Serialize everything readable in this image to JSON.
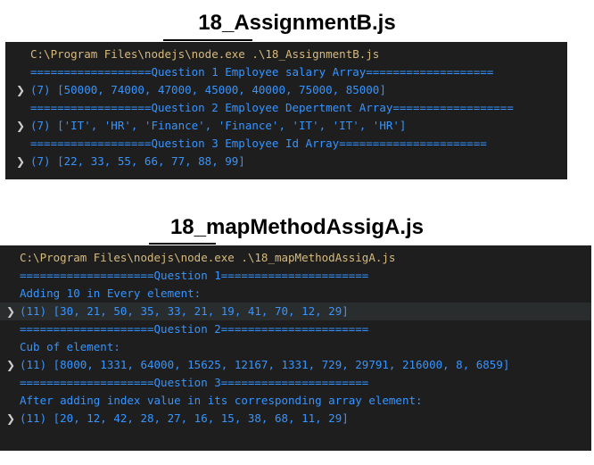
{
  "section1": {
    "heading": "18_AssignmentB.js",
    "lines": [
      {
        "text": "C:\\Program Files\\nodejs\\node.exe .\\18_AssignmentB.js"
      },
      {
        "text": "==================Question 1 Employee salary Array==================="
      },
      {
        "text": "(7) [50000, 74000, 47000, 45000, 40000, 75000, 85000]"
      },
      {
        "text": "==================Question 2 Employee Depertment Array=================="
      },
      {
        "text": "(7) ['IT', 'HR', 'Finance', 'Finance', 'IT', 'IT', 'HR']"
      },
      {
        "text": "==================Question 3 Employee Id Array======================"
      },
      {
        "text": "(7) [22, 33, 55, 66, 77, 88, 99]"
      }
    ]
  },
  "section2": {
    "heading": "18_mapMethodAssigA.js",
    "lines": [
      {
        "text": "C:\\Program Files\\nodejs\\node.exe .\\18_mapMethodAssigA.js"
      },
      {
        "text": "====================Question 1======================"
      },
      {
        "text": "Adding 10 in Every element:"
      },
      {
        "text": "(11) [30, 21, 50, 35, 33, 21, 19, 41, 70, 12, 29]"
      },
      {
        "text": "====================Question 2======================"
      },
      {
        "text": "Cub of element:"
      },
      {
        "text": "(11) [8000, 1331, 64000, 15625, 12167, 1331, 729, 29791, 216000, 8, 6859]"
      },
      {
        "text": "====================Question 3======================"
      },
      {
        "text": "After adding index value in its corresponding array element:"
      },
      {
        "text": "(11) [20, 12, 42, 28, 27, 16, 15, 38, 68, 11, 29]"
      }
    ]
  },
  "icons": {
    "expand": "chevron-right-icon"
  },
  "colors": {
    "terminal_bg": "#1e1e1e",
    "command_path": "#d7ba7d",
    "output_blue": "#3794ff",
    "highlight_row": "#2a2d2e"
  }
}
